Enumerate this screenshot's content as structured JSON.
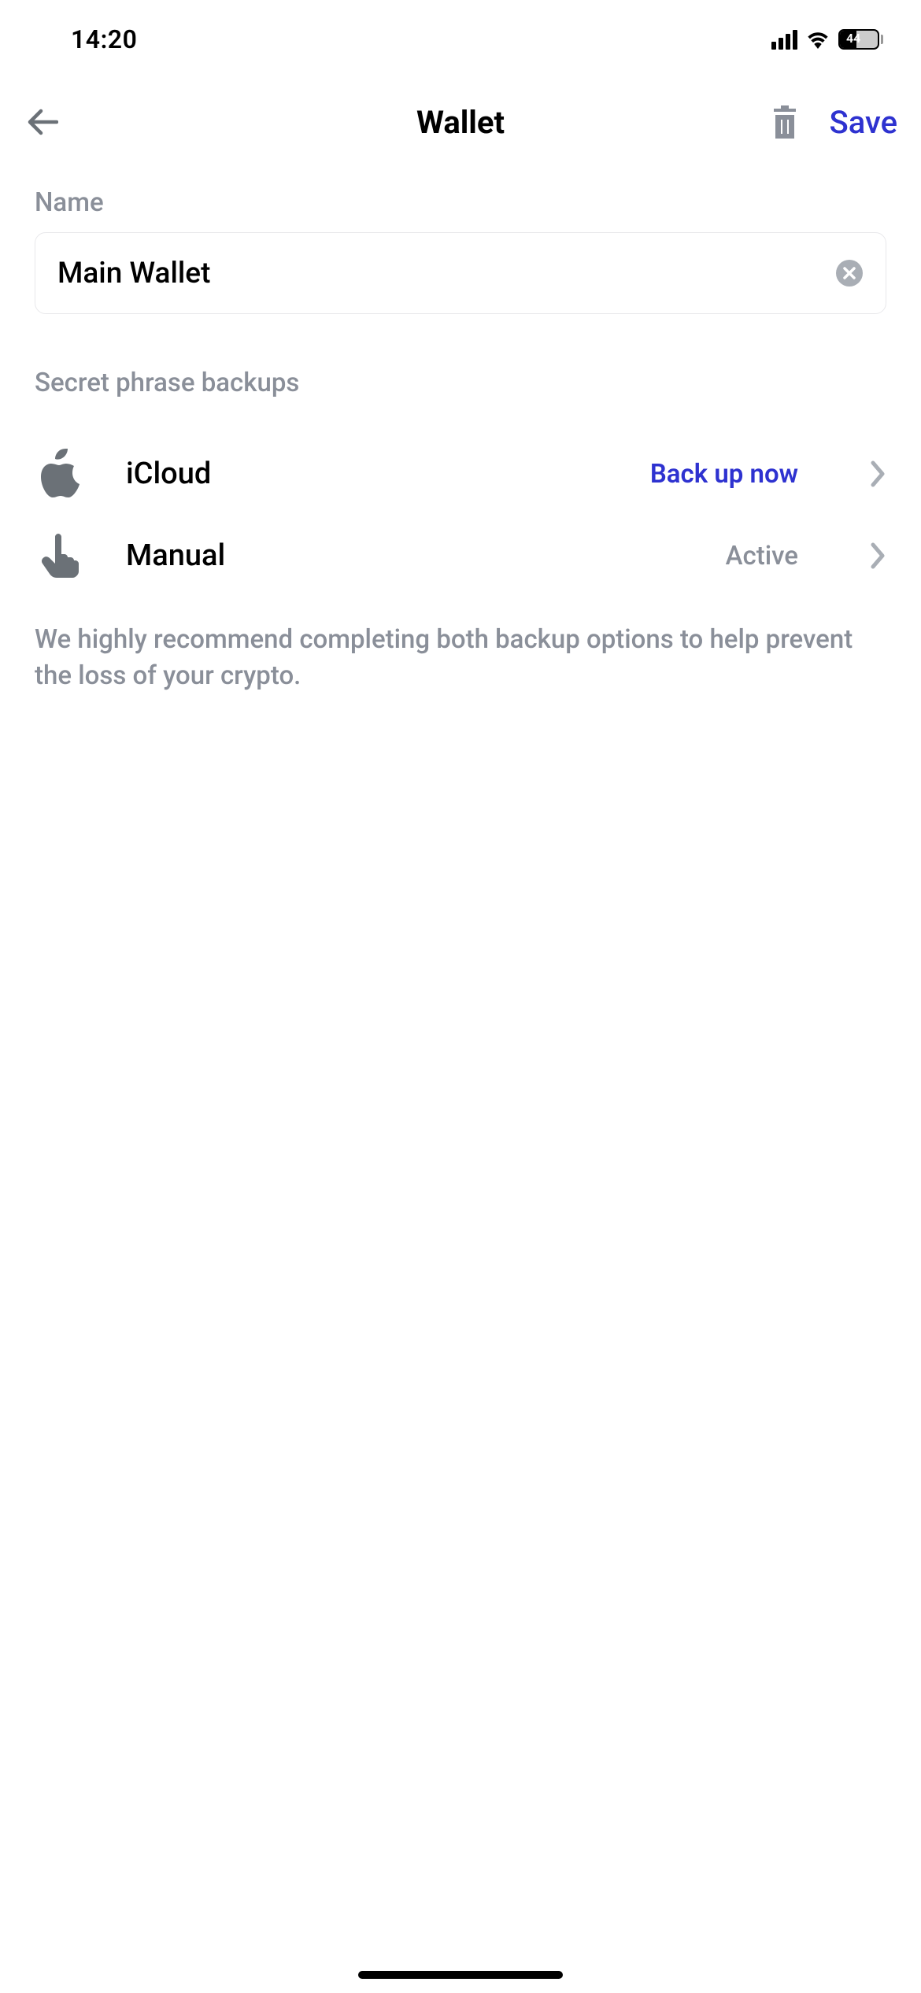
{
  "status": {
    "time": "14:20",
    "battery": "44"
  },
  "nav": {
    "title": "Wallet",
    "save_label": "Save"
  },
  "name_section": {
    "label": "Name",
    "value": "Main Wallet"
  },
  "backups_section": {
    "label": "Secret phrase backups",
    "hint": "We highly recommend completing both backup options to help prevent the loss of your crypto.",
    "items": [
      {
        "label": "iCloud",
        "status": "Back up now",
        "status_style": "primary"
      },
      {
        "label": "Manual",
        "status": "Active",
        "status_style": "secondary"
      }
    ]
  },
  "colors": {
    "accent": "#2E32D0",
    "text_secondary": "#8a8f99",
    "border": "#e8e8eb"
  }
}
